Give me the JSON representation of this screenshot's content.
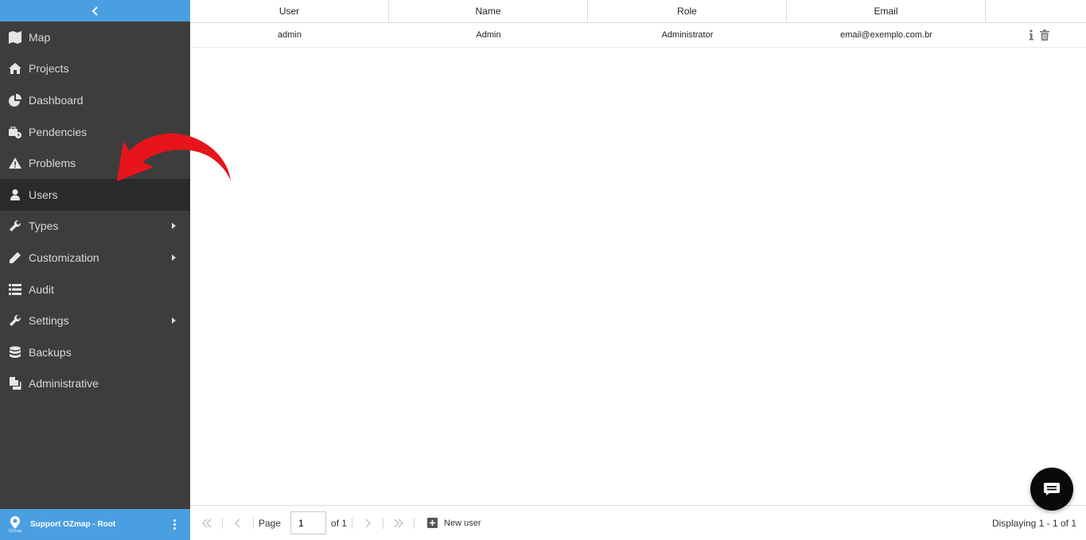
{
  "sidebar": {
    "items": [
      {
        "label": "Map",
        "icon": "map-icon"
      },
      {
        "label": "Projects",
        "icon": "home-icon"
      },
      {
        "label": "Dashboard",
        "icon": "pie-chart-icon"
      },
      {
        "label": "Pendencies",
        "icon": "briefcase-clock-icon"
      },
      {
        "label": "Problems",
        "icon": "warning-icon"
      },
      {
        "label": "Users",
        "icon": "user-icon",
        "active": true
      },
      {
        "label": "Types",
        "icon": "wrench-icon",
        "submenu": true
      },
      {
        "label": "Customization",
        "icon": "pencil-icon",
        "submenu": true
      },
      {
        "label": "Audit",
        "icon": "list-icon"
      },
      {
        "label": "Settings",
        "icon": "wrench-icon",
        "submenu": true
      },
      {
        "label": "Backups",
        "icon": "database-icon"
      },
      {
        "label": "Administrative",
        "icon": "documents-icon"
      }
    ],
    "user": {
      "name": "Support OZmap - Root",
      "logo_text": "OZmap"
    }
  },
  "grid": {
    "columns": [
      "User",
      "Name",
      "Role",
      "Email"
    ],
    "rows": [
      {
        "user": "admin",
        "name": "Admin",
        "role": "Administrator",
        "email": "email@exemplo.com.br"
      }
    ]
  },
  "toolbar": {
    "page_label": "Page",
    "page_value": "1",
    "of_label": "of 1",
    "new_user_label": "New user",
    "displaying": "Displaying 1 - 1 of 1"
  },
  "colors": {
    "sidebar_bg": "#3d3d3d",
    "accent": "#4a9fe0",
    "active_item": "#2a2a2a",
    "annotation_arrow": "#e8141b"
  }
}
